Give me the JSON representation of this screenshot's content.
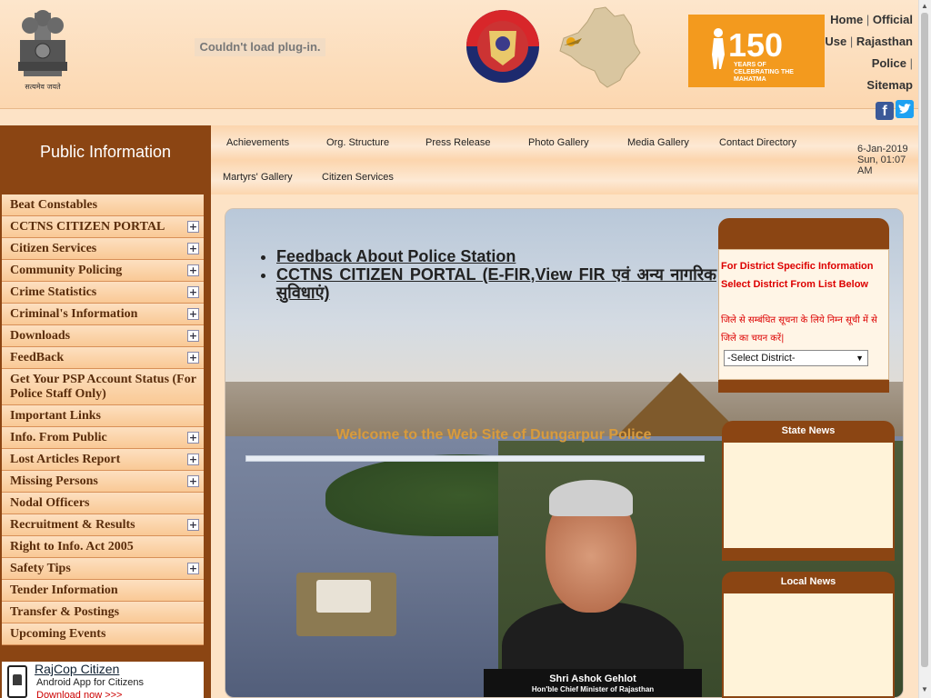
{
  "header": {
    "emblem_motto": "सत्यमेव जयते",
    "plugin_message": "Couldn't load plug-in.",
    "banner_number": "150",
    "banner_text": "YEARS OF CELEBRATING THE MAHATMA",
    "links": {
      "home": "Home",
      "sep1": "|",
      "official_use": "Official Use",
      "sep2": "|",
      "rajasthan_police": "Rajasthan Police",
      "sep3": "|",
      "sitemap": "Sitemap"
    },
    "facebook_glyph": "f"
  },
  "sidebar": {
    "title": "Public Information",
    "items": [
      {
        "label": "Beat Constables",
        "expandable": false
      },
      {
        "label": "CCTNS CITIZEN PORTAL",
        "expandable": true
      },
      {
        "label": "Citizen Services",
        "expandable": true
      },
      {
        "label": "Community Policing",
        "expandable": true
      },
      {
        "label": "Crime Statistics",
        "expandable": true
      },
      {
        "label": "Criminal's Information",
        "expandable": true
      },
      {
        "label": "Downloads",
        "expandable": true
      },
      {
        "label": "FeedBack",
        "expandable": true
      },
      {
        "label": "Get Your PSP Account Status (For Police Staff Only)",
        "expandable": false
      },
      {
        "label": "Important Links",
        "expandable": false
      },
      {
        "label": "Info. From Public",
        "expandable": true
      },
      {
        "label": "Lost Articles Report",
        "expandable": true
      },
      {
        "label": "Missing Persons",
        "expandable": true
      },
      {
        "label": "Nodal Officers",
        "expandable": false
      },
      {
        "label": "Recruitment & Results",
        "expandable": true
      },
      {
        "label": "Right to Info. Act 2005",
        "expandable": false
      },
      {
        "label": "Safety Tips",
        "expandable": true
      },
      {
        "label": "Tender Information",
        "expandable": false
      },
      {
        "label": "Transfer & Postings",
        "expandable": false
      },
      {
        "label": "Upcoming Events",
        "expandable": false
      }
    ],
    "plus_glyph": "+",
    "rajcop": {
      "title": "RajCop Citizen",
      "subtitle": "Android App for Citizens",
      "download": "Download now >>>"
    }
  },
  "topnav": {
    "items": [
      {
        "label": "Achievements"
      },
      {
        "label": "Org. Structure"
      },
      {
        "label": "Press Release"
      },
      {
        "label": "Photo Gallery"
      },
      {
        "label": "Media Gallery"
      },
      {
        "label": "Contact Directory"
      },
      {
        "label": "Martyrs' Gallery"
      },
      {
        "label": "Citizen Services"
      }
    ],
    "datetime": {
      "date": "6-Jan-2019",
      "time": "Sun, 01:07 AM"
    }
  },
  "main": {
    "links": [
      "Feedback About Police Station",
      "CCTNS CITIZEN PORTAL (E-FIR,View FIR एवं अन्य नागरिक सुविधाएं)"
    ],
    "welcome": "Welcome to the Web Site of Dungarpur Police",
    "cm": {
      "name": "Shri Ashok Gehlot",
      "role": "Hon'ble Chief Minister of Rajasthan"
    }
  },
  "district": {
    "text_en": "For District Specific Information Select District From List Below",
    "text_hi": "जिले से सम्बंधित सूचना के लिये निम्न सूची में से जिले का चयन करें|",
    "select_value": "-Select District-",
    "arrow": "▼"
  },
  "news": {
    "state_title": "State News",
    "local_title": "Local News"
  },
  "scroll": {
    "up": "▲",
    "down": "▼"
  },
  "colors": {
    "accent_brown": "#8b4513",
    "page_peach": "#fde3c6",
    "alert_red": "#dd0000",
    "banner_orange": "#f39a1e"
  }
}
